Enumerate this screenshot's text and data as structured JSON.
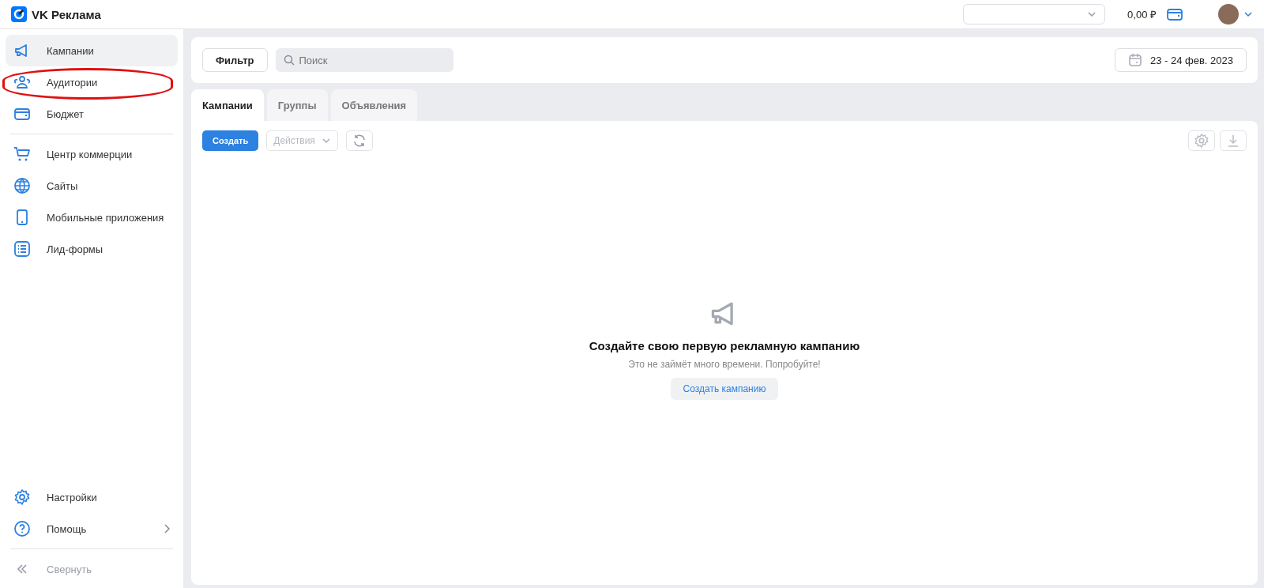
{
  "header": {
    "logo": "VK Реклама",
    "balance": "0,00 ₽"
  },
  "sidebar": {
    "groups": [
      [
        {
          "label": "Кампании",
          "kind": "megaphone",
          "selected": true,
          "annotated": false
        },
        {
          "label": "Аудитории",
          "kind": "users",
          "selected": false,
          "annotated": true
        },
        {
          "label": "Бюджет",
          "kind": "wallet",
          "selected": false,
          "annotated": false
        }
      ],
      [
        {
          "label": "Центр коммерции",
          "kind": "cart",
          "selected": false,
          "annotated": false
        },
        {
          "label": "Сайты",
          "kind": "globe",
          "selected": false,
          "annotated": false
        },
        {
          "label": "Мобильные приложения",
          "kind": "phone",
          "selected": false,
          "annotated": false
        },
        {
          "label": "Лид-формы",
          "kind": "list",
          "selected": false,
          "annotated": false
        }
      ]
    ],
    "bottom": [
      {
        "label": "Настройки",
        "kind": "gear",
        "submenu": false
      },
      {
        "label": "Помощь",
        "kind": "help",
        "submenu": true
      }
    ],
    "collapse": "Свернуть"
  },
  "filter_bar": {
    "filter_button": "Фильтр",
    "search": {
      "placeholder": "Поиск"
    },
    "date_range": "23 - 24 фев. 2023"
  },
  "tabs": [
    {
      "label": "Кампании",
      "selected": true
    },
    {
      "label": "Группы",
      "selected": false
    },
    {
      "label": "Объявления",
      "selected": false
    }
  ],
  "toolbar": {
    "create": "Создать",
    "actions": {
      "label": "Действия",
      "disabled": true
    }
  },
  "empty_state": {
    "title": "Создайте свою первую рекламную кампанию",
    "subtitle": "Это не займёт много времени. Попробуйте!",
    "button": "Создать кампанию"
  }
}
